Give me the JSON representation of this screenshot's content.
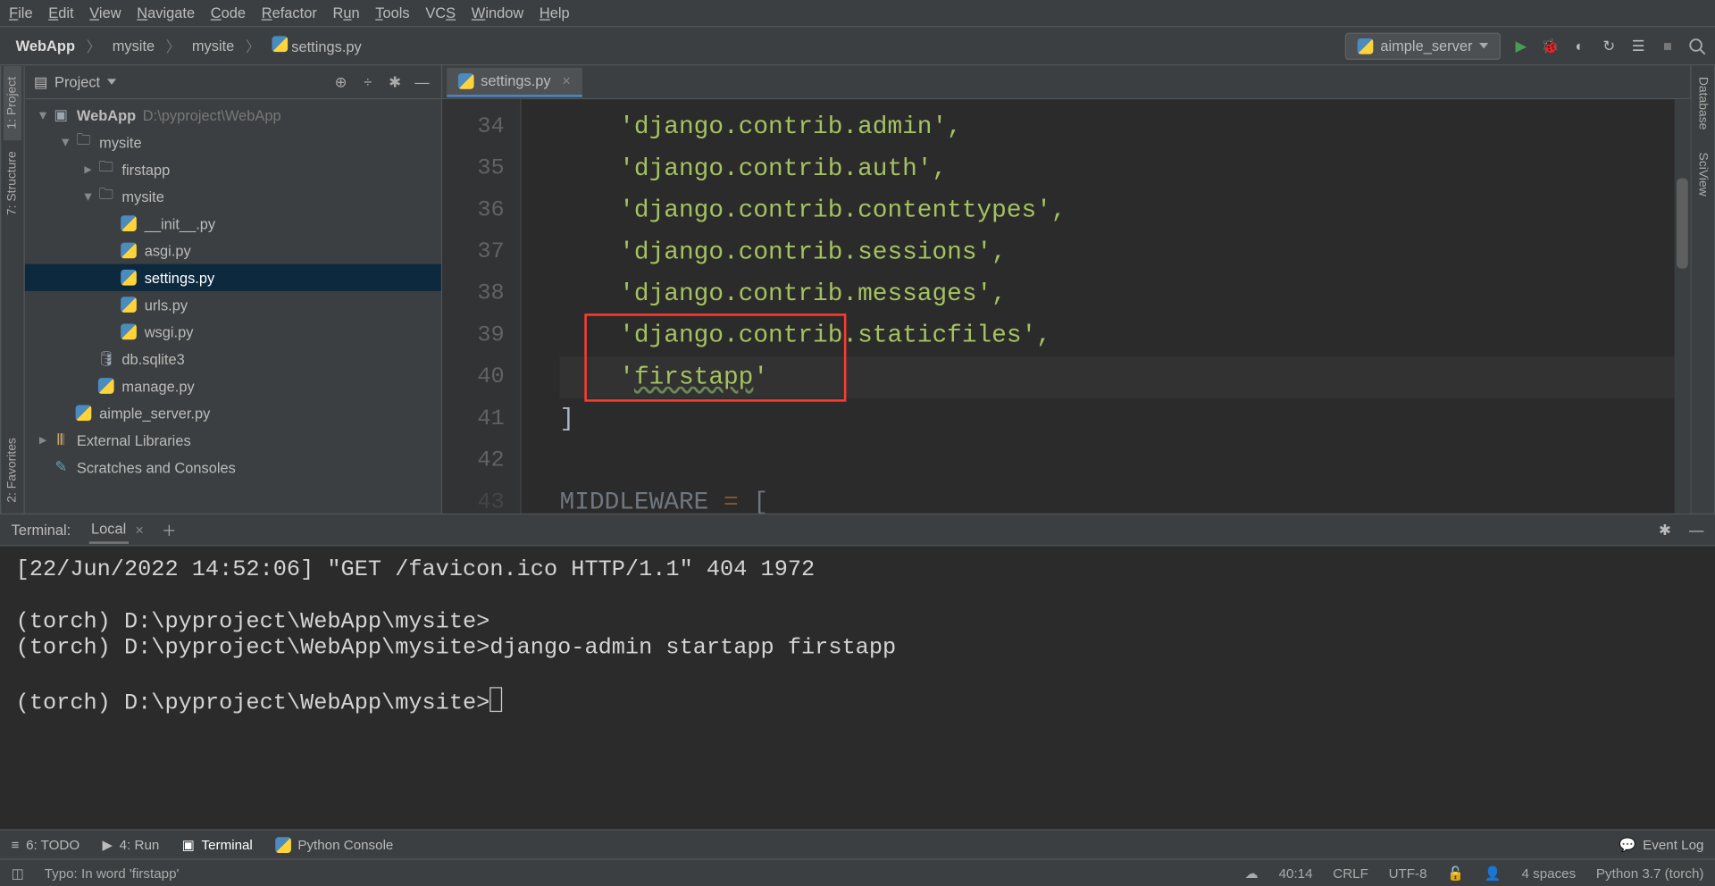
{
  "menu": [
    "File",
    "Edit",
    "View",
    "Navigate",
    "Code",
    "Refactor",
    "Run",
    "Tools",
    "VCS",
    "Window",
    "Help"
  ],
  "breadcrumbs": [
    "WebApp",
    "mysite",
    "mysite",
    "settings.py"
  ],
  "runConfig": "aimple_server",
  "leftStripe": [
    "1: Project",
    "7: Structure"
  ],
  "rightStripe": [
    "Database",
    "SciView"
  ],
  "favStripe": "2: Favorites",
  "projectPanel": {
    "title": "Project"
  },
  "tree": {
    "root": {
      "name": "WebApp",
      "path": "D:\\pyproject\\WebApp"
    },
    "mysite": "mysite",
    "firstapp": "firstapp",
    "mysite2": "mysite",
    "files": {
      "init": "__init__.py",
      "asgi": "asgi.py",
      "settings": "settings.py",
      "urls": "urls.py",
      "wsgi": "wsgi.py"
    },
    "db": "db.sqlite3",
    "manage": "manage.py",
    "aimple": "aimple_server.py",
    "ext": "External Libraries",
    "scratch": "Scratches and Consoles"
  },
  "editorTab": "settings.py",
  "code": {
    "lines": [
      34,
      35,
      36,
      37,
      38,
      39,
      40,
      41,
      42,
      43
    ],
    "l34": "    'django.contrib.admin',",
    "l35": "    'django.contrib.auth',",
    "l36": "    'django.contrib.contenttypes',",
    "l37": "    'django.contrib.sessions',",
    "l38": "    'django.contrib.messages',",
    "l39": "    'django.contrib.staticfiles',",
    "l40_pre": "    '",
    "l40_word": "firstapp",
    "l40_post": "'",
    "l41": "]",
    "l43_var": "MIDDLEWARE",
    "l43_eq": " = ",
    "l43_br": "["
  },
  "terminal": {
    "title": "Terminal:",
    "tab": "Local",
    "lines": [
      "[22/Jun/2022 14:52:06] \"GET /favicon.ico HTTP/1.1\" 404 1972",
      "",
      "(torch) D:\\pyproject\\WebApp\\mysite>",
      "(torch) D:\\pyproject\\WebApp\\mysite>django-admin startapp firstapp",
      "",
      "(torch) D:\\pyproject\\WebApp\\mysite>"
    ]
  },
  "bottomTools": {
    "todo": "6: TODO",
    "run": "4: Run",
    "terminal": "Terminal",
    "pyconsole": "Python Console",
    "eventlog": "Event Log"
  },
  "status": {
    "msg": "Typo: In word 'firstapp'",
    "pos": "40:14",
    "eol": "CRLF",
    "enc": "UTF-8",
    "indent": "4 spaces",
    "interp": "Python 3.7 (torch)"
  }
}
